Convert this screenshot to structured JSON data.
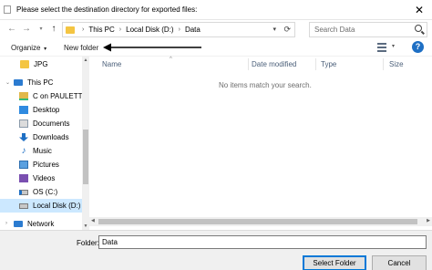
{
  "window": {
    "title": "Please select the destination directory for exported files:"
  },
  "address": {
    "crumbs": [
      "This PC",
      "Local Disk (D:)",
      "Data"
    ]
  },
  "search": {
    "placeholder": "Search Data"
  },
  "toolbar": {
    "organize_label": "Organize",
    "new_folder_label": "New folder"
  },
  "nav": {
    "items": [
      {
        "label": "JPG",
        "icon": "folder-icon"
      },
      {
        "label": "This PC",
        "icon": "pc-icon"
      },
      {
        "label": "C on PAULETTEL",
        "icon": "network-drive-icon"
      },
      {
        "label": "Desktop",
        "icon": "desktop-icon"
      },
      {
        "label": "Documents",
        "icon": "documents-icon"
      },
      {
        "label": "Downloads",
        "icon": "downloads-icon"
      },
      {
        "label": "Music",
        "icon": "music-icon"
      },
      {
        "label": "Pictures",
        "icon": "pictures-icon"
      },
      {
        "label": "Videos",
        "icon": "videos-icon"
      },
      {
        "label": "OS (C:)",
        "icon": "drive-icon"
      },
      {
        "label": "Local Disk (D:)",
        "icon": "drive-icon",
        "selected": true
      },
      {
        "label": "Network",
        "icon": "network-icon"
      }
    ]
  },
  "columns": {
    "name": "Name",
    "date": "Date modified",
    "type": "Type",
    "size": "Size"
  },
  "empty_message": "No items match your search.",
  "footer": {
    "folder_label": "Folder:",
    "folder_value": "Data",
    "select_label": "Select Folder",
    "cancel_label": "Cancel"
  },
  "colors": {
    "accent": "#0078d7",
    "selection": "#cce8ff",
    "header_text": "#4c607a"
  }
}
